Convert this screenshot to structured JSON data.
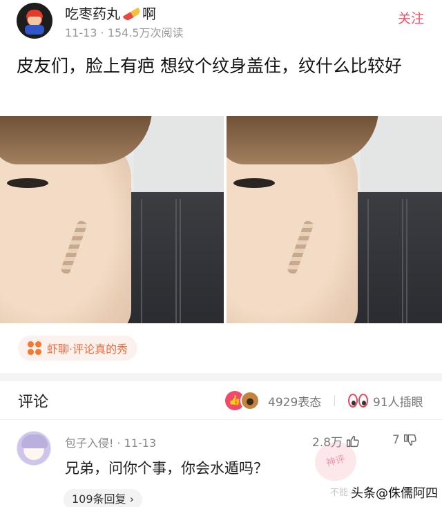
{
  "header": {
    "author_name": "吃枣药丸",
    "author_suffix": "啊",
    "date": "11-13",
    "meta_sep": "·",
    "reads": "154.5万次阅读",
    "follow_label": "关注"
  },
  "post": {
    "title": "皮友们，脸上有疤 想纹个纹身盖住，纹什么比较好"
  },
  "source_chip": {
    "label": "虾聊·评论真的秀"
  },
  "comments_bar": {
    "label": "评论",
    "reactions": "4929表态",
    "peek": "91人插眼"
  },
  "comment": {
    "name_date": "包子入侵! · 11-13",
    "likes": "2.8万",
    "dislikes": "7",
    "text": "兄弟，问你个事，你会水遁吗？",
    "replies": "109条回复 ›",
    "stamp": "神评"
  },
  "watermark": {
    "faint": "不能",
    "strong": "头条@侏儒阿四"
  },
  "colors": {
    "accent": "#f0506b",
    "chip_text": "#f06a3a"
  }
}
